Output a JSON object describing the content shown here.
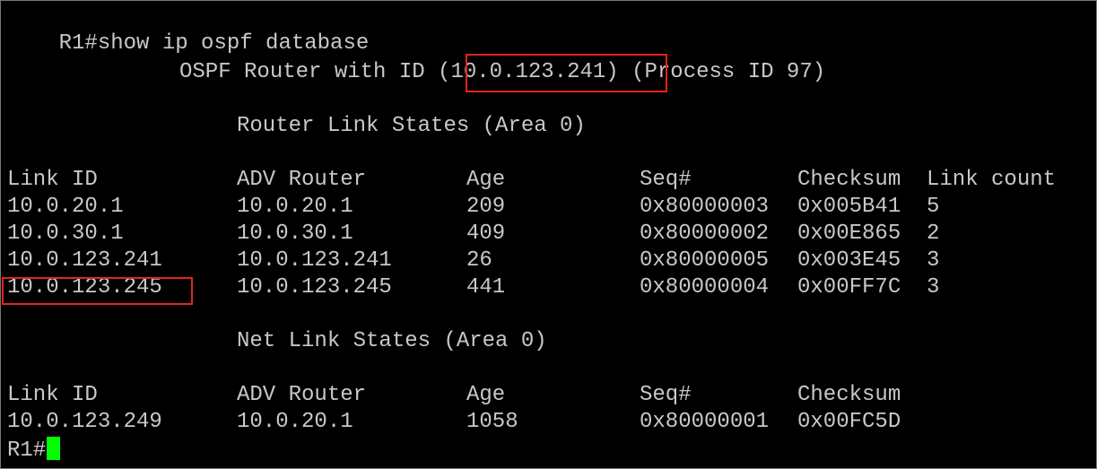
{
  "colors": {
    "background": "#000000",
    "text": "#c8c8c8",
    "highlight_box": "#e1251b",
    "cursor": "#00ff00"
  },
  "command": "R1#show ip ospf database",
  "header": {
    "prefix": "OSPF Router with ID ",
    "router_id": "(10.0.123.241)",
    "suffix": " (Process ID 97)"
  },
  "router_section": {
    "title": "Router Link States (Area 0)",
    "columns": [
      "Link ID",
      "ADV Router",
      "Age",
      "Seq#",
      "Checksum",
      "Link count"
    ],
    "rows": [
      [
        "10.0.20.1",
        "10.0.20.1",
        "209",
        "0x80000003",
        "0x005B41",
        "5"
      ],
      [
        "10.0.30.1",
        "10.0.30.1",
        "409",
        "0x80000002",
        "0x00E865",
        "2"
      ],
      [
        "10.0.123.241",
        "10.0.123.241",
        "26",
        "0x80000005",
        "0x003E45",
        "3"
      ],
      [
        "10.0.123.245",
        "10.0.123.245",
        "441",
        "0x80000004",
        "0x00FF7C",
        "3"
      ]
    ]
  },
  "net_section": {
    "title": "Net Link States (Area 0)",
    "columns": [
      "Link ID",
      "ADV Router",
      "Age",
      "Seq#",
      "Checksum"
    ],
    "rows": [
      [
        "10.0.123.249",
        "10.0.20.1",
        "1058",
        "0x80000001",
        "0x00FC5D"
      ]
    ]
  },
  "prompt": "R1#",
  "highlights": [
    "router-id",
    "link-id-10.0.123.245"
  ]
}
